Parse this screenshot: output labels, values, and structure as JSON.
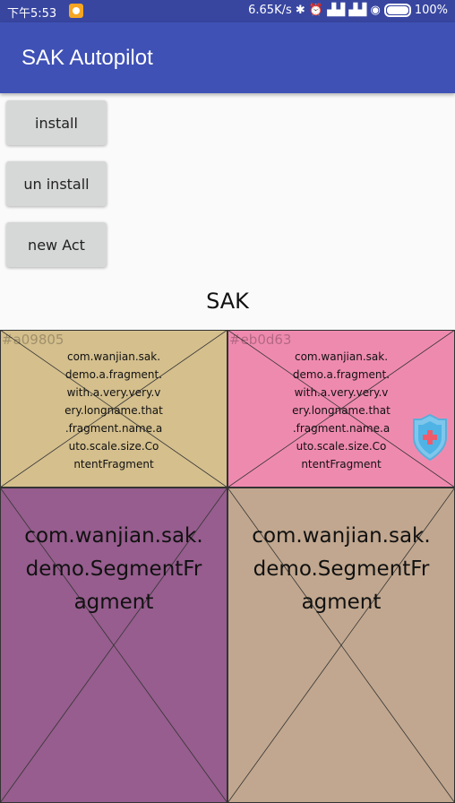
{
  "status_bar": {
    "time": "下午5:53",
    "right_text": "6.65K/s ✱ ⏰ ▟▟ ▟▟ ◉",
    "battery": "100%"
  },
  "app": {
    "title": "SAK Autopilot"
  },
  "buttons": {
    "install": "install",
    "uninstall": "un install",
    "new_act": "new Act"
  },
  "sak_label": "SAK",
  "fragments": {
    "top_left": {
      "hex": "#a09805",
      "lines": [
        "com.wanjian.sak.",
        "demo.a.fragment.",
        "with.a.very.very.v",
        "ery.longname.that",
        ".fragment.name.a",
        "uto.scale.size.Co",
        "ntentFragment"
      ],
      "color": "#d4bf8d"
    },
    "top_right": {
      "hex": "#eb0d63",
      "lines": [
        "com.wanjian.sak.",
        "demo.a.fragment.",
        "with.a.very.very.v",
        "ery.longname.that",
        ".fragment.name.a",
        "uto.scale.size.Co",
        "ntentFragment"
      ],
      "color": "#ef8aaf"
    },
    "bottom_left": {
      "lines": [
        "com.wanjian.sak.",
        "demo.SegmentFr",
        "agment"
      ],
      "color": "#965d8e"
    },
    "bottom_right": {
      "lines": [
        "com.wanjian.sak.",
        "demo.SegmentFr",
        "agment"
      ],
      "color": "#c1a78f"
    }
  }
}
